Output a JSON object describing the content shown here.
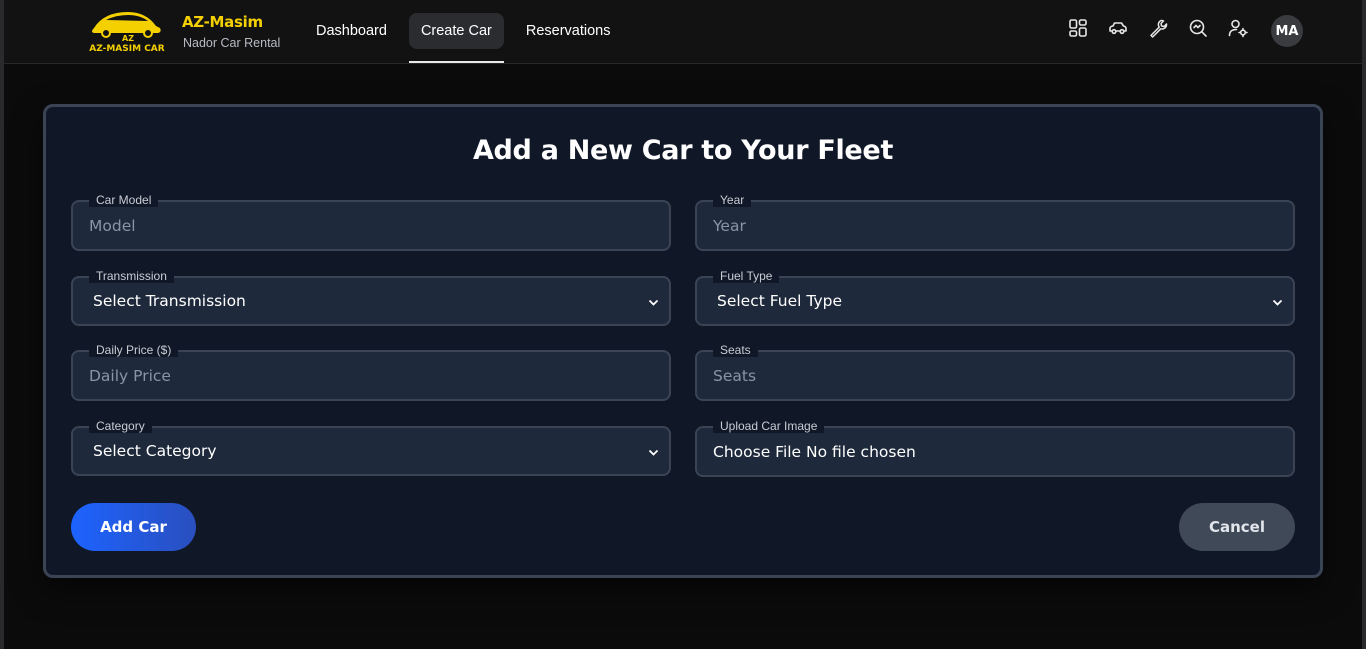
{
  "brand": {
    "logo_text": "AZ-MASIM CAR",
    "logo_monogram": "AZ",
    "name": "AZ-Masim",
    "subtitle": "Nador Car Rental"
  },
  "nav": {
    "links": [
      {
        "label": "Dashboard",
        "active": false
      },
      {
        "label": "Create Car",
        "active": true
      },
      {
        "label": "Reservations",
        "active": false
      }
    ],
    "icons": [
      "grid-icon",
      "car-icon",
      "wrench-icon",
      "search-zoom-icon",
      "user-settings-icon"
    ],
    "avatar": "MA"
  },
  "form": {
    "title": "Add a New Car to Your Fleet",
    "fields": {
      "model": {
        "label": "Car Model",
        "placeholder": "Model"
      },
      "year": {
        "label": "Year",
        "placeholder": "Year"
      },
      "transmission": {
        "label": "Transmission",
        "value": "Select Transmission"
      },
      "fuel": {
        "label": "Fuel Type",
        "value": "Select Fuel Type"
      },
      "price": {
        "label": "Daily Price ($)",
        "placeholder": "Daily Price"
      },
      "seats": {
        "label": "Seats",
        "placeholder": "Seats"
      },
      "category": {
        "label": "Category",
        "value": "Select Category"
      },
      "image": {
        "label": "Upload Car Image",
        "value": "Choose File No file chosen"
      }
    },
    "submit_label": "Add Car",
    "cancel_label": "Cancel"
  },
  "colors": {
    "accent_blue": "#1d63ff",
    "brand_yellow": "#f5d000",
    "card_bg": "#101828",
    "field_bg": "#1e293b"
  }
}
